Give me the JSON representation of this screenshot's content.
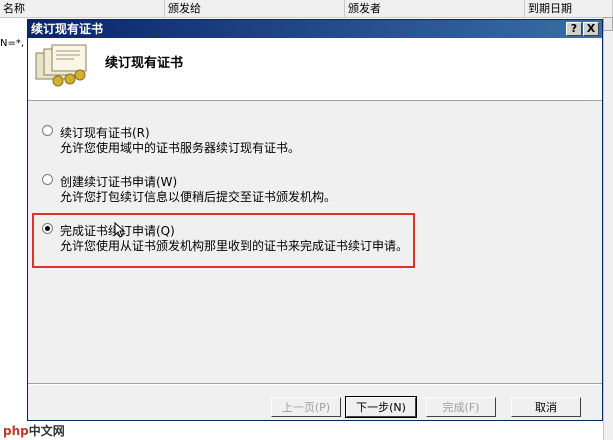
{
  "background_list": {
    "columns": [
      "名称",
      "颁发给",
      "颁发者",
      "到期日期"
    ],
    "row_fragment": "N=*, "
  },
  "dialog": {
    "window_title": "续订现有证书",
    "help_button": "?",
    "close_button": "X",
    "header_title": "续订现有证书",
    "options": [
      {
        "label": "续订现有证书(R)",
        "description": "允许您使用域中的证书服务器续订现有证书。",
        "checked": false
      },
      {
        "label": "创建续订证书申请(W)",
        "description": "允许您打包续订信息以便稍后提交至证书颁发机构。",
        "checked": false
      },
      {
        "label": "完成证书续订申请(Q)",
        "description": "允许您使用从证书颁发机构那里收到的证书来完成证书续订申请。",
        "checked": true
      }
    ],
    "buttons": {
      "back": "上一页(P)",
      "next": "下一步(N)",
      "finish": "完成(F)",
      "cancel": "取消"
    }
  },
  "watermark": {
    "text1": "php",
    "text2": "中文网"
  },
  "colors": {
    "titlebar": "#0a246a",
    "highlight_border": "#e0302c",
    "dialog_bg": "#f0f0f0"
  }
}
